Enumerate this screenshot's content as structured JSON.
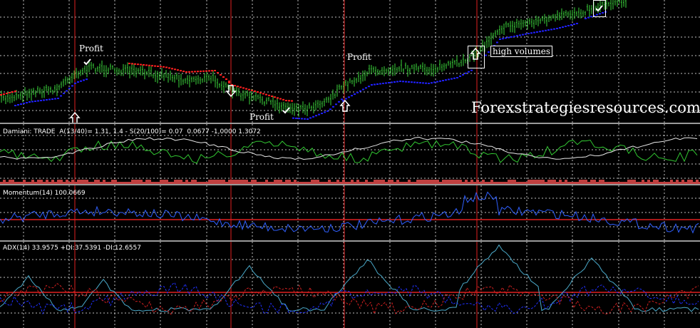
{
  "colors": {
    "background": "#000000",
    "grid": "#ffffff",
    "bull_candle": "#3cd63c",
    "bear_candle": "#3cd63c",
    "sar_down": "#ff2020",
    "sar_up": "#2020ff",
    "vertical_line": "#e02020",
    "damiani_green": "#32c832",
    "damiani_white": "#e8e8e8",
    "damiani_bar": "#c04040",
    "momentum_line": "#3060ff",
    "momentum_level": "#e02020",
    "adx_main": "#4aa9c9",
    "adx_plus": "#2030ff",
    "adx_minus": "#d02020",
    "adx_level": "#e02020"
  },
  "main_chart": {
    "annotations": [
      {
        "text": "Profit"
      },
      {
        "text": "Profit"
      },
      {
        "text": "Profit"
      }
    ],
    "high_volumes_label": "high volumes",
    "watermark": "Forexstrategiesresources.com",
    "signal_icons": [
      "up-arrow-icon",
      "down-arrow-icon",
      "up-arrow-icon",
      "up-arrow-icon"
    ],
    "check_icons": [
      "check-icon",
      "check-icon",
      "check-icon"
    ]
  },
  "indicators": {
    "damiani": {
      "label": "Damiani: TRADE  A(13/40)= 1.31, 1.4 - S(20/100)= 0.07  0.0677 -1,0000 1.3072"
    },
    "momentum": {
      "label": "Momentum(14) 100.0669"
    },
    "adx": {
      "label": "ADX(14) 33.9575 +DI:37.5391 -DI:12.6557"
    }
  }
}
